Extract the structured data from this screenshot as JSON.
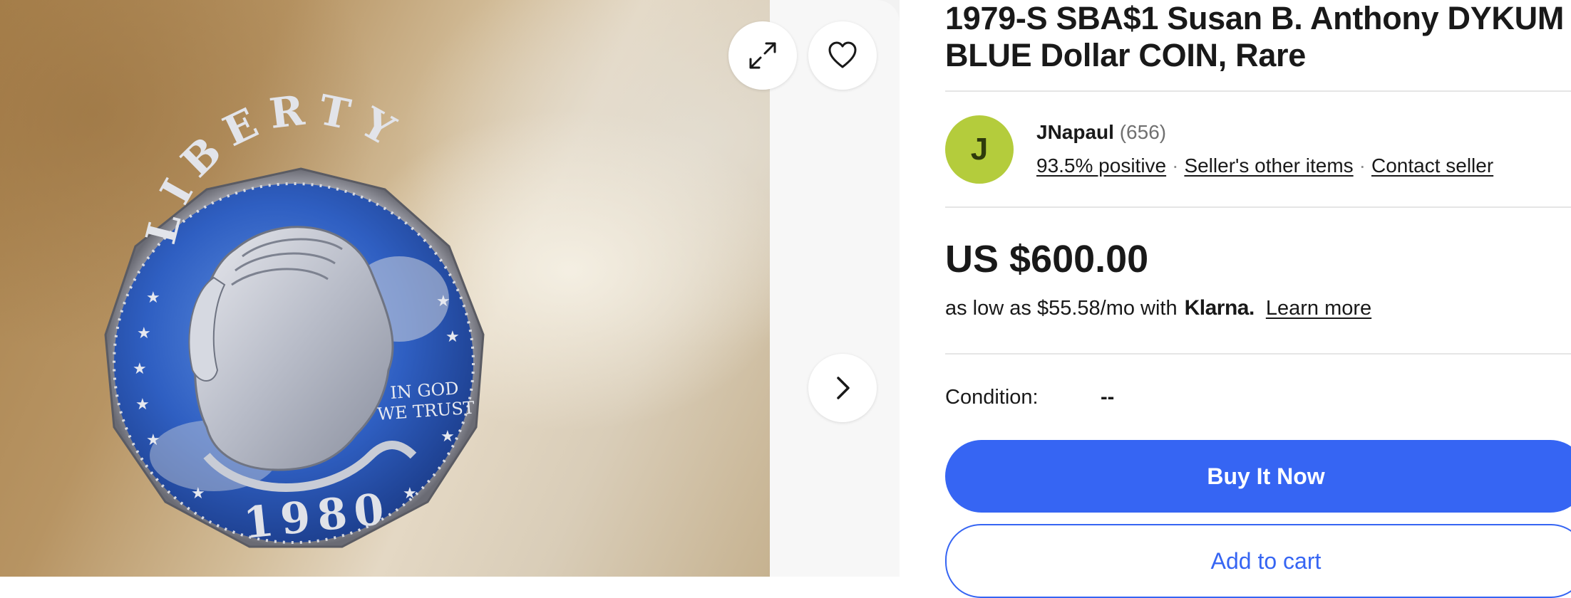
{
  "gallery": {
    "coin_inscriptions": [
      "LIBERTY",
      "IN GOD WE TRUST",
      "1980"
    ],
    "icons": {
      "expand": "expand-icon",
      "watch": "heart-icon",
      "next": "chevron-right-icon"
    }
  },
  "listing": {
    "title": "1979-S SBA$1 Susan B. Anthony DYKUM BLUE Dollar COIN, Rare"
  },
  "seller": {
    "avatar_letter": "J",
    "name": "JNapaul",
    "feedback_count": "(656)",
    "positive": "93.5% positive",
    "other_items": "Seller's other items",
    "contact": "Contact seller"
  },
  "price": {
    "amount": "US $600.00",
    "financing_text": "as low as $55.58/mo with",
    "financing_brand": "Klarna.",
    "learn_more": "Learn more"
  },
  "condition": {
    "label": "Condition:",
    "value": "--"
  },
  "actions": {
    "buy_now": "Buy It Now",
    "add_to_cart": "Add to cart"
  },
  "colors": {
    "primary": "#3665f3",
    "avatar": "#b4cc3c",
    "text": "#191919",
    "muted": "#707070"
  }
}
